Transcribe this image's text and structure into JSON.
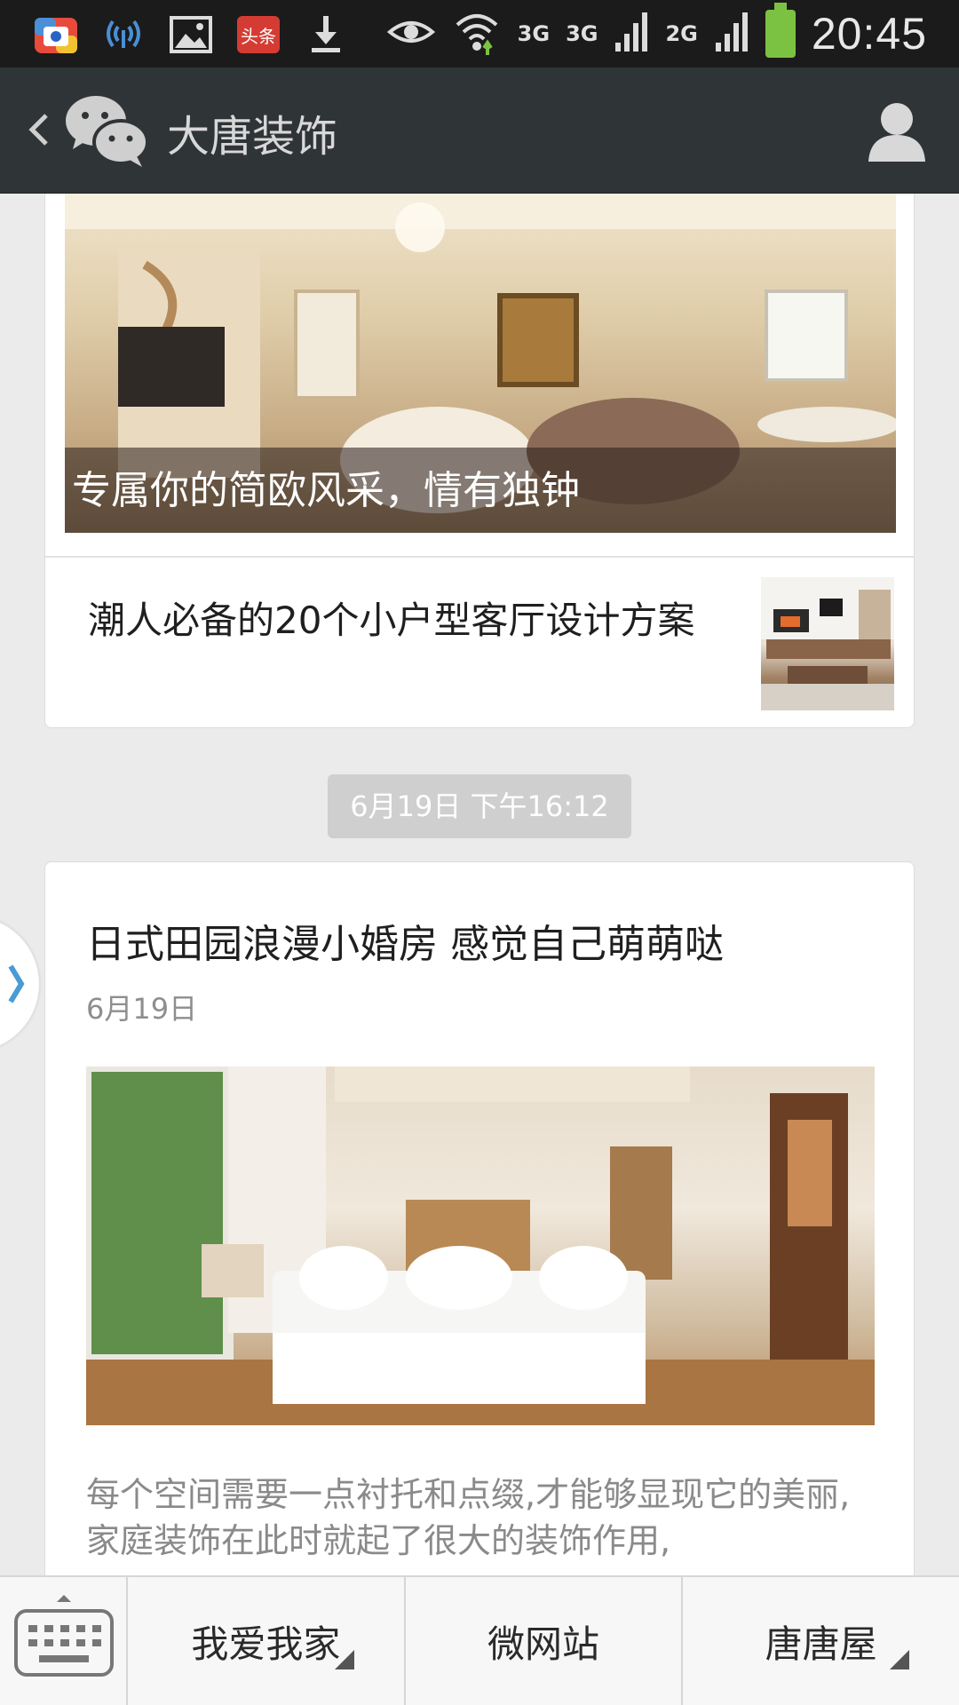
{
  "status_bar": {
    "time": "20:45",
    "networks": [
      "3G",
      "3G",
      "2G"
    ],
    "left_icons": [
      "baidu-app-icon",
      "wireless-icon",
      "image-icon",
      "toutiao-icon",
      "download-icon"
    ],
    "toutiao_label": "头条"
  },
  "header": {
    "title": "大唐装饰",
    "back_icon": "chevron-left-icon",
    "logo_icon": "wechat-chat-icon",
    "profile_icon": "person-icon"
  },
  "feed": {
    "top_card": {
      "cover_caption": "专属你的简欧风采，情有独钟",
      "sub_article_title": "潮人必备的20个小户型客厅设计方案"
    },
    "timestamp": "6月19日 下午16:12",
    "article": {
      "title": "日式田园浪漫小婚房 感觉自己萌萌哒",
      "date": "6月19日",
      "summary": "每个空间需要一点衬托和点缀,才能够显现它的美丽,家庭装饰在此时就起了很大的装饰作用,"
    }
  },
  "bottom_menu": {
    "keyboard_icon": "keyboard-icon",
    "items": [
      {
        "label": "我爱我家",
        "has_submenu": true
      },
      {
        "label": "微网站",
        "has_submenu": false
      },
      {
        "label": "唐唐屋",
        "has_submenu": true
      }
    ]
  },
  "colors": {
    "header_bg": "#2f3437",
    "status_bar_bg": "#1b1b1b",
    "page_bg": "#ebebeb",
    "timestamp_bg": "#cfcfcf",
    "battery": "#7cc242"
  }
}
